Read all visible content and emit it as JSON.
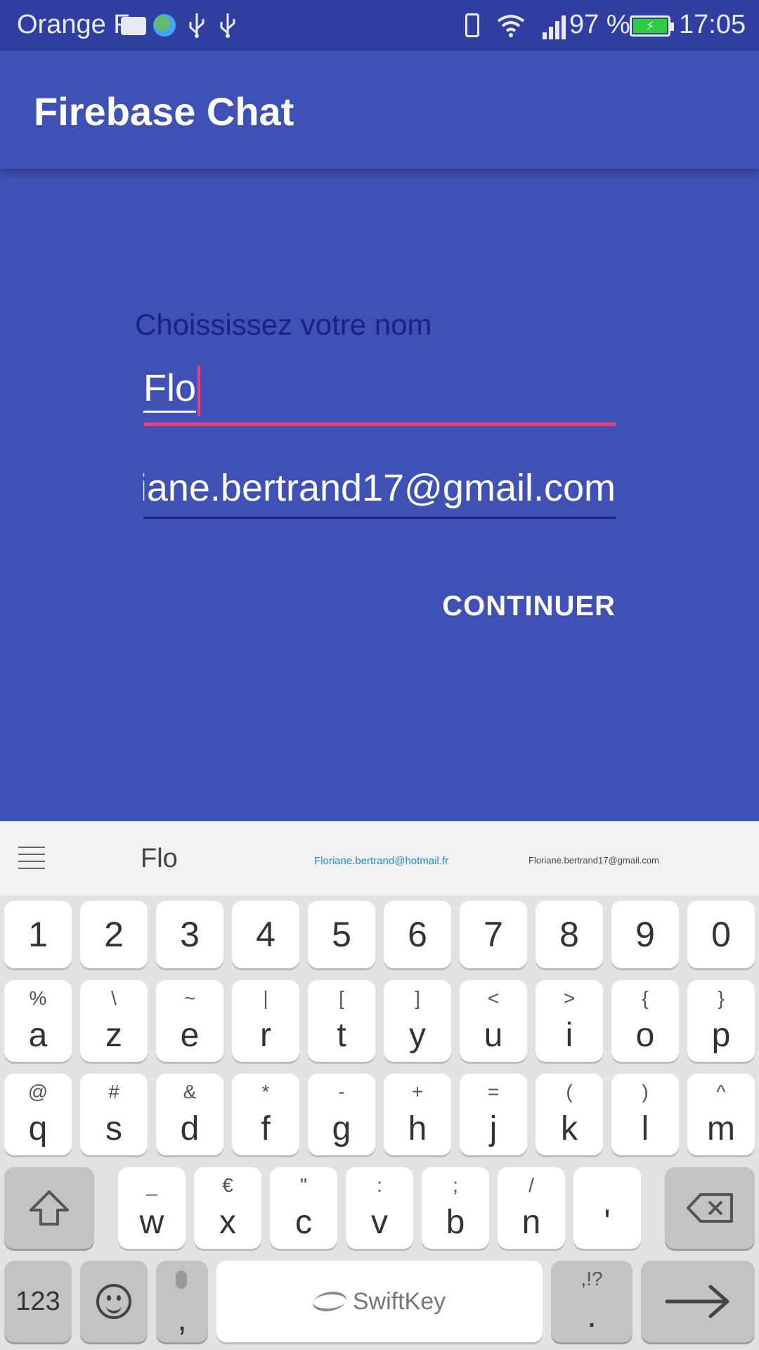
{
  "status_bar": {
    "carrier": "Orange F",
    "battery_percent": "97 %",
    "time": "17:05",
    "icons": [
      "keyboard-icon",
      "globe-icon",
      "usb-icon",
      "usb-icon",
      "vibrate-icon",
      "wifi-icon",
      "signal-icon",
      "battery-charging-icon"
    ]
  },
  "app_bar": {
    "title": "Firebase Chat"
  },
  "form": {
    "label": "Choississez votre nom",
    "name_value": "Flo",
    "email_value": "iane.bertrand17@gmail.com",
    "continue_label": "CONTINUER"
  },
  "colors": {
    "primary": "#3F51B5",
    "primary_dark": "#303F9F",
    "accent": "#EC407A",
    "label_text": "#1A237E"
  },
  "keyboard": {
    "brand": "SwiftKey",
    "suggestions": [
      "Flo",
      "Floriane.bertrand@hotmail.fr",
      "Floriane.bertrand17@gmail.com"
    ],
    "number_row": [
      "1",
      "2",
      "3",
      "4",
      "5",
      "6",
      "7",
      "8",
      "9",
      "0"
    ],
    "row1": [
      {
        "main": "a",
        "sub": "%"
      },
      {
        "main": "z",
        "sub": "\\"
      },
      {
        "main": "e",
        "sub": "~"
      },
      {
        "main": "r",
        "sub": "|"
      },
      {
        "main": "t",
        "sub": "["
      },
      {
        "main": "y",
        "sub": "]"
      },
      {
        "main": "u",
        "sub": "<"
      },
      {
        "main": "i",
        "sub": ">"
      },
      {
        "main": "o",
        "sub": "{"
      },
      {
        "main": "p",
        "sub": "}"
      }
    ],
    "row2": [
      {
        "main": "q",
        "sub": "@"
      },
      {
        "main": "s",
        "sub": "#"
      },
      {
        "main": "d",
        "sub": "&"
      },
      {
        "main": "f",
        "sub": "*"
      },
      {
        "main": "g",
        "sub": "-"
      },
      {
        "main": "h",
        "sub": "+"
      },
      {
        "main": "j",
        "sub": "="
      },
      {
        "main": "k",
        "sub": "("
      },
      {
        "main": "l",
        "sub": ")"
      },
      {
        "main": "m",
        "sub": "^"
      }
    ],
    "row3": [
      {
        "main": "w",
        "sub": "_"
      },
      {
        "main": "x",
        "sub": "€"
      },
      {
        "main": "c",
        "sub": "\""
      },
      {
        "main": "v",
        "sub": ":"
      },
      {
        "main": "b",
        "sub": ";"
      },
      {
        "main": "n",
        "sub": "/"
      },
      {
        "main": "'",
        "sub": ""
      }
    ],
    "bottom": {
      "numbers_key": "123",
      "comma_key": ",",
      "period_key": ".",
      "period_sub": ",!?"
    }
  }
}
